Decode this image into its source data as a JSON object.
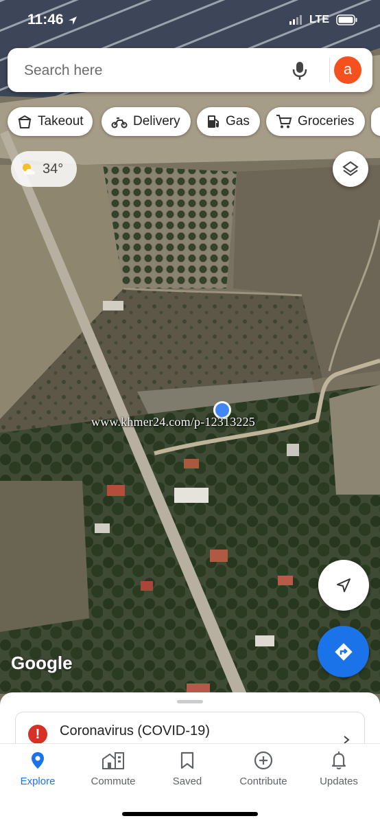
{
  "status_bar": {
    "time": "11:46",
    "network": "LTE"
  },
  "search": {
    "placeholder": "Search here",
    "avatar_letter": "a"
  },
  "chips": [
    {
      "label": "Takeout",
      "icon": "takeout-icon"
    },
    {
      "label": "Delivery",
      "icon": "delivery-icon"
    },
    {
      "label": "Gas",
      "icon": "gas-icon"
    },
    {
      "label": "Groceries",
      "icon": "cart-icon"
    }
  ],
  "weather": {
    "temperature": "34°",
    "icon": "partly-cloudy-icon"
  },
  "map": {
    "watermark": "www.khmer24.com/p-12313225",
    "logo": "Google",
    "layer": "satellite"
  },
  "sheet": {
    "card_title": "Coronavirus (COVID-19)"
  },
  "nav": {
    "items": [
      {
        "label": "Explore",
        "icon": "explore-icon",
        "active": true
      },
      {
        "label": "Commute",
        "icon": "commute-icon"
      },
      {
        "label": "Saved",
        "icon": "bookmark-icon"
      },
      {
        "label": "Contribute",
        "icon": "add-circle-icon"
      },
      {
        "label": "Updates",
        "icon": "bell-icon"
      }
    ]
  },
  "colors": {
    "accent": "#1a73e8",
    "avatar": "#f4511e",
    "alert": "#d93025",
    "location": "#4285f4"
  }
}
